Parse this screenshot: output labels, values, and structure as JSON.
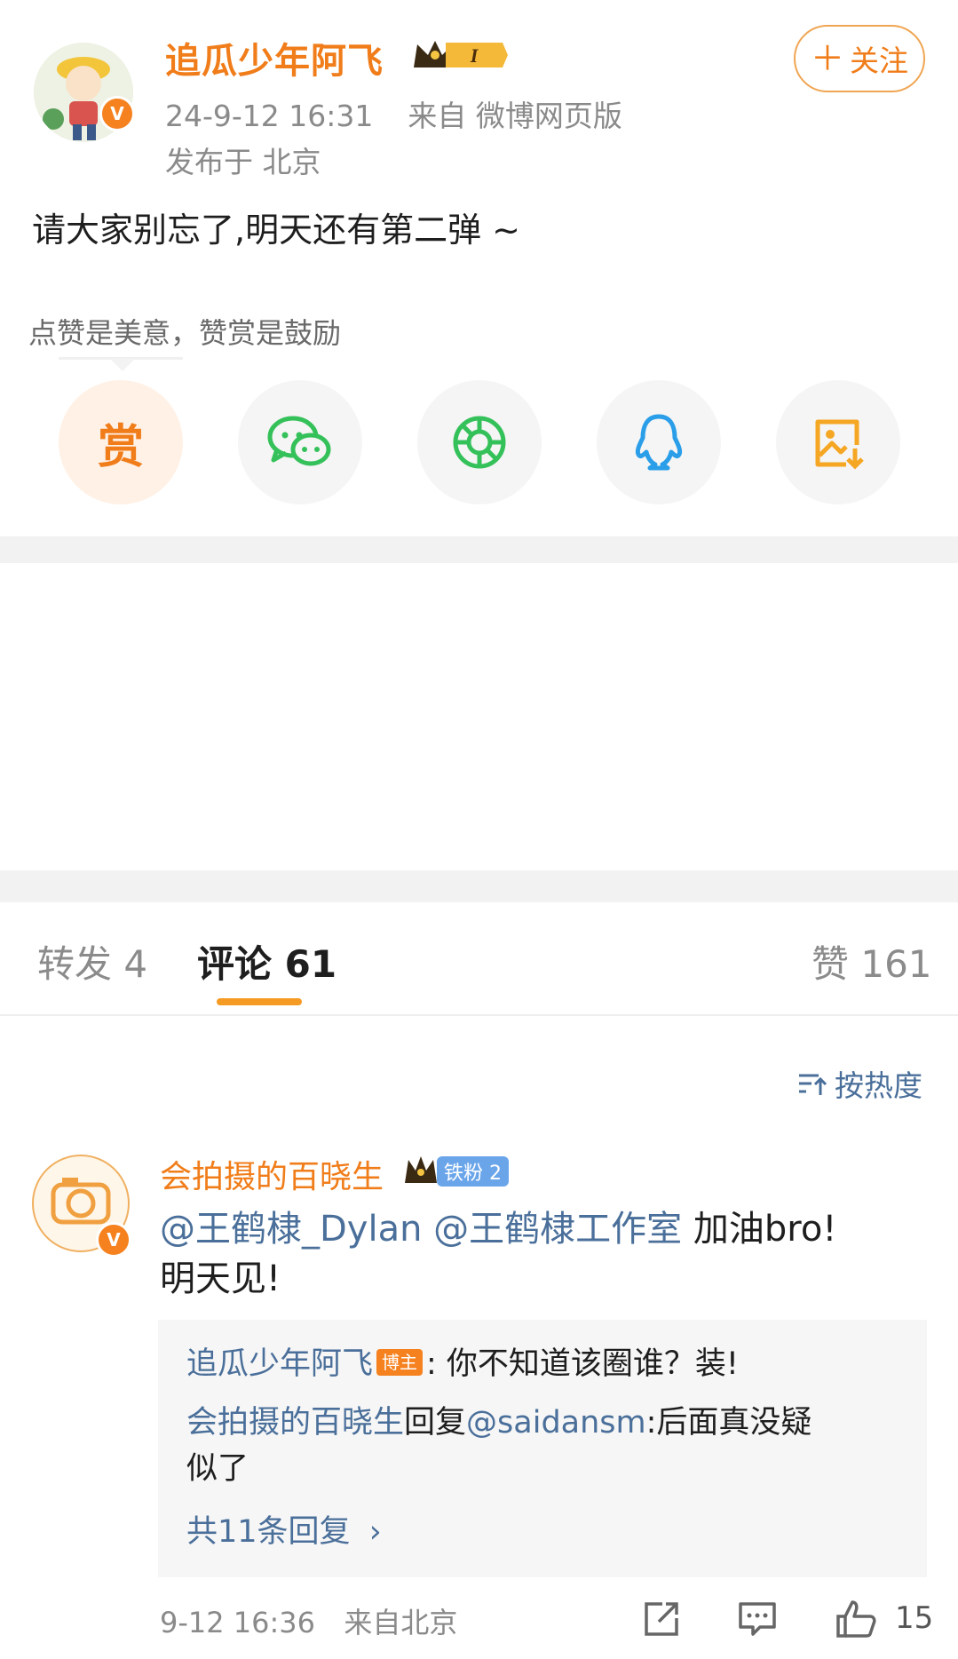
{
  "post": {
    "author": "追瓜少年阿飞",
    "vip_level": "I",
    "timestamp": "24-9-12 16:31",
    "source": "来自 微博网页版",
    "location": "发布于 北京",
    "follow_label": "关注",
    "content": "请大家别忘了,明天还有第二弹 ~"
  },
  "reward": {
    "tip": "点赞是美意，赞赏是鼓励",
    "reward_label": "赏"
  },
  "tabs": {
    "repost": "转发 4",
    "comments": "评论 61",
    "likes": "赞 161"
  },
  "sort": {
    "label": "按热度"
  },
  "comment": {
    "author": "会拍摄的百晓生",
    "fan_badge": "铁粉 2",
    "mention1": "@王鹤棣_Dylan",
    "mention2": "@王鹤棣工作室",
    "text1": " 加油bro!",
    "text2": "明天见!",
    "replies": [
      {
        "author": "追瓜少年阿飞",
        "tag": "博主",
        "text": ": 你不知道该圈谁？装!"
      },
      {
        "author": "会拍摄的百晓生",
        "reply_word": "回复",
        "mention": "@saidansm",
        "text": ":后面真没疑",
        "text_wrap": "似了"
      }
    ],
    "more_replies": "共11条回复",
    "time": "9-12 16:36",
    "location": "来自北京",
    "like_count": "15"
  },
  "colors": {
    "brand_orange": "#f07d1a",
    "link_blue": "#4a6f9a",
    "wechat_green": "#35c15a",
    "qq_blue": "#2a9ee8",
    "save_orange": "#f5a623"
  },
  "icons": [
    "verified-v-icon",
    "crown-vip-icon",
    "plus-icon",
    "wechat-icon",
    "moments-icon",
    "qq-icon",
    "save-image-icon",
    "sort-icon",
    "share-icon",
    "comment-icon",
    "thumbs-up-icon"
  ]
}
